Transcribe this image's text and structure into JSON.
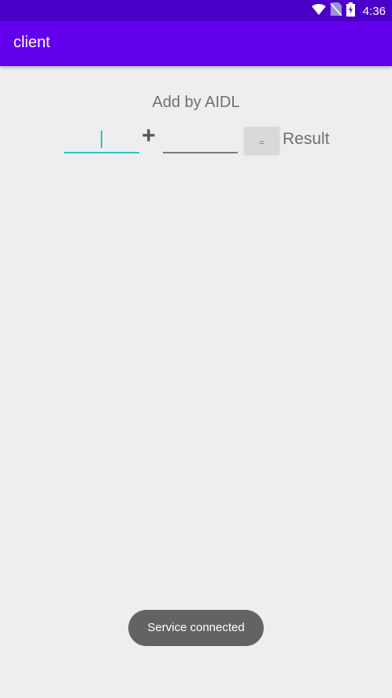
{
  "status_bar": {
    "time": "4:36",
    "icons": [
      "wifi-icon",
      "no-sim-icon",
      "battery-charging-icon"
    ],
    "background": "#4a00c8"
  },
  "app_bar": {
    "title": "client",
    "background": "#6200ee"
  },
  "content": {
    "heading": "Add by AIDL",
    "first_operand": {
      "value": "",
      "placeholder": ""
    },
    "operator": "+",
    "second_operand": {
      "value": "",
      "placeholder": ""
    },
    "equals_label": "=",
    "result_label": "Result"
  },
  "toast": {
    "message": "Service connected"
  },
  "colors": {
    "accent": "#27c6c6",
    "background": "#eeeeee"
  }
}
